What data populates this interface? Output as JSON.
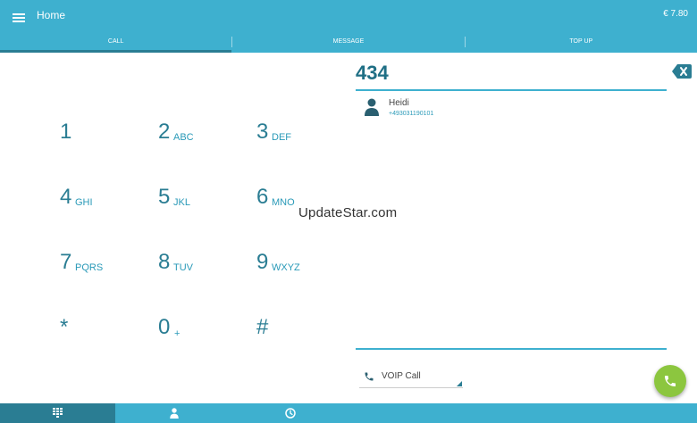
{
  "header": {
    "menu_icon": "menu-icon",
    "title": "Home",
    "balance": "€ 7.80"
  },
  "tabs": [
    {
      "label": "CALL",
      "active": true
    },
    {
      "label": "MESSAGE",
      "active": false
    },
    {
      "label": "TOP UP",
      "active": false
    }
  ],
  "dialpad": {
    "keys": [
      {
        "digit": "1",
        "letters": ""
      },
      {
        "digit": "2",
        "letters": "ABC"
      },
      {
        "digit": "3",
        "letters": "DEF"
      },
      {
        "digit": "4",
        "letters": "GHI"
      },
      {
        "digit": "5",
        "letters": "JKL"
      },
      {
        "digit": "6",
        "letters": "MNO"
      },
      {
        "digit": "7",
        "letters": "PQRS"
      },
      {
        "digit": "8",
        "letters": "TUV"
      },
      {
        "digit": "9",
        "letters": "WXYZ"
      },
      {
        "digit": "*",
        "letters": ""
      },
      {
        "digit": "0",
        "letters": "+"
      },
      {
        "digit": "#",
        "letters": ""
      }
    ]
  },
  "number_field": {
    "value": "434",
    "backspace_icon": "backspace-icon"
  },
  "suggestions": [
    {
      "name": "Heidi",
      "number": "+493031190101",
      "icon": "person-icon"
    }
  ],
  "watermark": "UpdateStar.com",
  "call_type": {
    "selected": "VOIP Call",
    "icon": "phone-icon"
  },
  "call_button": {
    "icon": "phone-icon"
  },
  "bottom_nav": [
    {
      "icon": "dialpad-icon",
      "active": true
    },
    {
      "icon": "person-icon",
      "active": false
    },
    {
      "icon": "clock-icon",
      "active": false
    }
  ],
  "colors": {
    "primary": "#3eb0cf",
    "primary_dark": "#2a7d93",
    "call_green": "#8cc63f"
  }
}
